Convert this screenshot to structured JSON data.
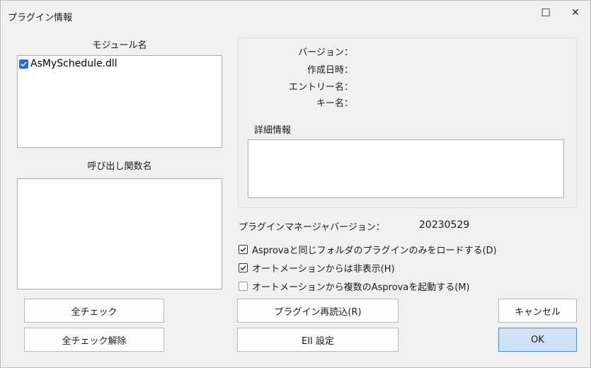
{
  "window": {
    "title": "プラグイン情報",
    "maximize_glyph": "☐",
    "close_glyph": "✕"
  },
  "modules": {
    "label": "モジュール名",
    "items": [
      {
        "name": "AsMySchedule.dll",
        "checked": true
      }
    ]
  },
  "functions": {
    "label": "呼び出し関数名",
    "items": []
  },
  "info": {
    "version_label": "バージョン：",
    "version_value": "",
    "date_label": "作成日時：",
    "date_value": "",
    "entry_label": "エントリー名：",
    "entry_value": "",
    "key_label": "キー名：",
    "key_value": "",
    "detail_label": "詳細情報",
    "detail_value": ""
  },
  "manager": {
    "label": "プラグインマネージャバージョン：",
    "value": "20230529"
  },
  "options": [
    {
      "label": "Asprovaと同じフォルダのプラグインのみをロードする(D)",
      "checked": true
    },
    {
      "label": "オートメーションからは非表示(H)",
      "checked": true
    },
    {
      "label": "オートメーションから複数のAsprovaを起動する(M)",
      "checked": false
    }
  ],
  "buttons": {
    "check_all": "全チェック",
    "uncheck_all": "全チェック解除",
    "reload": "プラグイン再読込(R)",
    "eii_settings": "EII 設定",
    "cancel": "キャンセル",
    "ok": "OK"
  },
  "colors": {
    "accent": "#1e6ed6",
    "ok_button_bg": "#cfe2f7",
    "ok_button_border": "#4b8fd8"
  }
}
